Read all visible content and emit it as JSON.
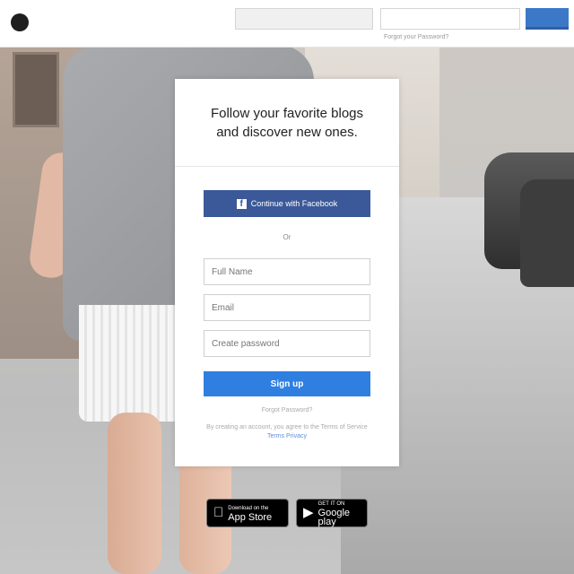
{
  "header": {
    "logo_text": "",
    "email_placeholder": "",
    "password_placeholder": "",
    "forgot_password": "Forgot your Password?",
    "login_label": ""
  },
  "card": {
    "tagline": "Follow your favorite blogs and discover new ones.",
    "facebook_button": "Continue with Facebook",
    "facebook_icon": "f",
    "or_label": "Or",
    "full_name_placeholder": "Full Name",
    "email_placeholder": "Email",
    "password_placeholder": "Create password",
    "signup_button": "Sign up",
    "forgot_password": "Forgot Password?",
    "terms_prefix": "By creating an account, you agree to the Terms of",
    "terms_service": "Service",
    "terms_link": "Terms",
    "privacy_link": "Privacy"
  },
  "badges": {
    "apple_small": "Download on the",
    "apple_big": "App Store",
    "google_small": "GET IT ON",
    "google_big": "Google play"
  },
  "colors": {
    "facebook": "#3b5998",
    "signup": "#2f7fe0",
    "login": "#3c78c8"
  }
}
